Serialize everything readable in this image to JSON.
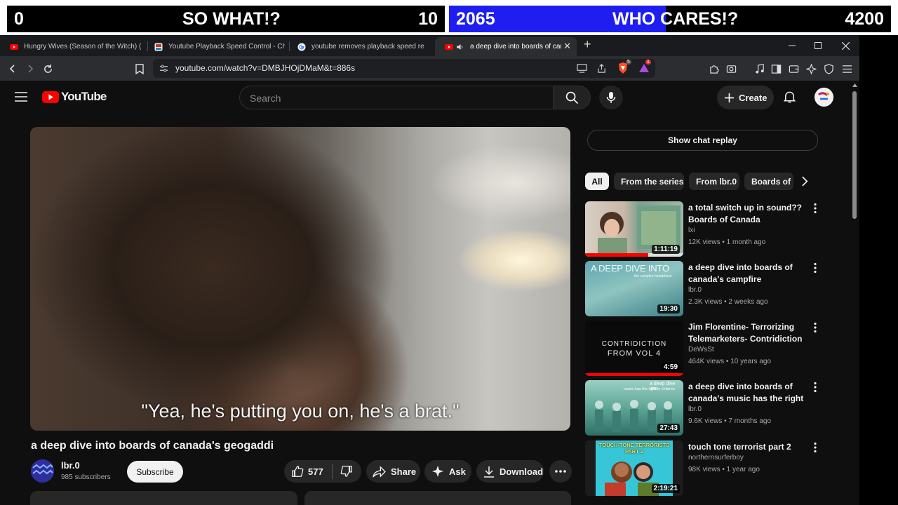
{
  "scoreboard": {
    "left_score": "0",
    "left_label": "SO WHAT!?",
    "left_count": "10",
    "right_score": "2065",
    "right_label": "WHO CARES!?",
    "right_count": "4200",
    "right_progress": 0.49,
    "fill_color": "#1e1ef0"
  },
  "browser": {
    "tabs": [
      {
        "title": "Hungry Wives (Season of the Witch) (",
        "icon": "youtube-icon"
      },
      {
        "title": "Youtube Playback Speed Control - Ch",
        "icon": "extension-icon"
      },
      {
        "title": "youtube removes playback speed re",
        "icon": "google-icon"
      },
      {
        "title": "a deep dive into boards of canada",
        "icon": "youtube-icon",
        "active": true
      }
    ],
    "new_tab": "+",
    "url": "youtube.com/watch?v=DMBJHOjDMaM&t=886s",
    "brave_badge": "5",
    "alert_badge": "1"
  },
  "youtube": {
    "logo_text": "YouTube",
    "search_placeholder": "Search",
    "create_label": "Create",
    "video": {
      "subtitle": "\"Yea, he's putting you on, he's a brat.\"",
      "title": "a deep dive into boards of canada's geogaddi",
      "channel": "lbr.0",
      "subscribers": "985 subscribers",
      "subscribe_label": "Subscribe",
      "likes": "577",
      "share_label": "Share",
      "ask_label": "Ask",
      "download_label": "Download"
    },
    "chat_replay_label": "Show chat replay",
    "chips": [
      "All",
      "From the series",
      "From lbr.0",
      "Boards of"
    ],
    "recommendations": [
      {
        "title": "a total switch up in sound?? Boards of Canada",
        "channel": "lxi",
        "meta": "12K views • 1 month ago",
        "duration": "1:11:19"
      },
      {
        "title": "a deep dive into boards of canada's campfire headphase",
        "channel": "lbr.0",
        "meta": "2.3K views • 2 weeks ago",
        "duration": "19:30",
        "thumb_text": "A DEEP DIVE INTO",
        "thumb_sub": "the campfire headphase"
      },
      {
        "title": "Jim Florentine- Terrorizing Telemarketers- Contridiction",
        "channel": "DeWsSt",
        "meta": "464K views • 10 years ago",
        "duration": "4:59",
        "thumb_text": "CONTRIDICTION",
        "thumb_sub": "FROM VOL 4"
      },
      {
        "title": "a deep dive into boards of canada's music has the right t...",
        "channel": "lbr.0",
        "meta": "9.6K views • 7 months ago",
        "duration": "27:43",
        "thumb_text": "a deep dive into",
        "thumb_sub": "music has the right to children"
      },
      {
        "title": "touch tone terrorist part 2",
        "channel": "northernsurferboy",
        "meta": "98K views • 1 year ago",
        "duration": "2:19:21",
        "thumb_text": "TOUCH-TONE TERRORISTS PART 2"
      }
    ]
  }
}
